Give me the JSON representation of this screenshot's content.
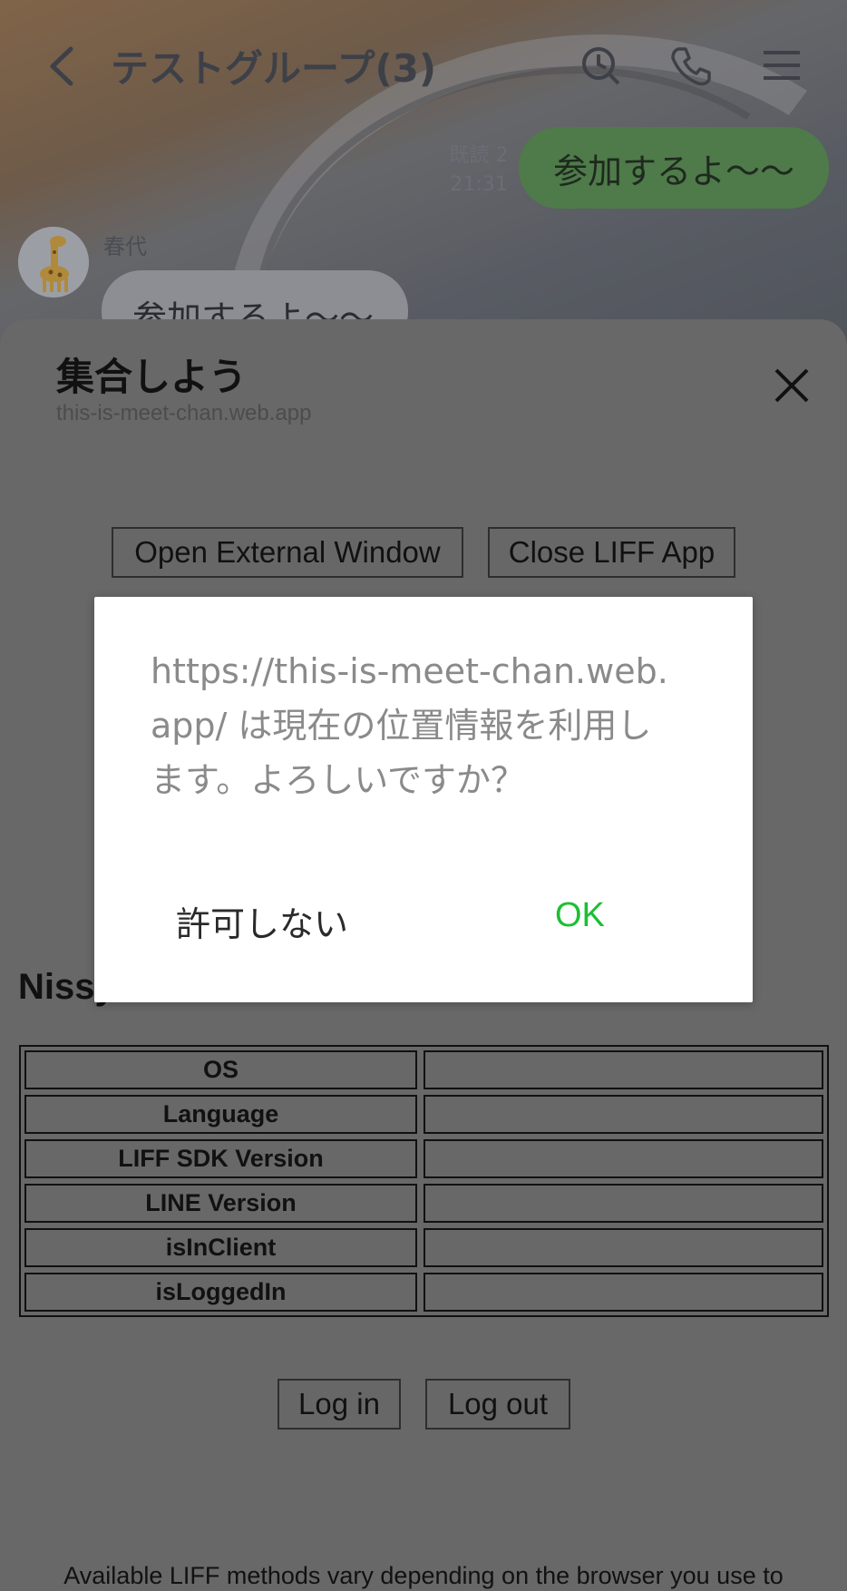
{
  "chat": {
    "title": "テストグループ(3)",
    "read_label": "既読 2",
    "sent_time": "21:31",
    "outgoing_message": "参加するよ〜〜",
    "sender_name": "春代",
    "incoming_message": "参加するよ〜〜"
  },
  "liff": {
    "title": "集合しよう",
    "url": "this-is-meet-chan.web.app",
    "open_external_label": "Open External Window",
    "close_liff_label": "Close LIFF App",
    "section_heading": "Nissy",
    "table_rows": [
      {
        "key": "OS",
        "value": ""
      },
      {
        "key": "Language",
        "value": ""
      },
      {
        "key": "LIFF SDK Version",
        "value": ""
      },
      {
        "key": "LINE Version",
        "value": ""
      },
      {
        "key": "isInClient",
        "value": ""
      },
      {
        "key": "isLoggedIn",
        "value": ""
      }
    ],
    "login_label": "Log in",
    "logout_label": "Log out",
    "footer_text": "Available LIFF methods vary depending on the browser you use to"
  },
  "dialog": {
    "message": "https://this-is-meet-chan.web.app/ は現在の位置情報を利用します。よろしいですか？",
    "deny_label": "許可しない",
    "ok_label": "OK",
    "ok_color": "#1cbf34"
  }
}
